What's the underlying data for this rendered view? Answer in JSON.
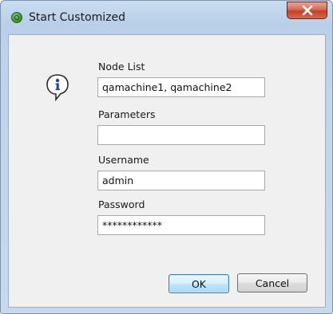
{
  "window": {
    "title": "Start Customized",
    "close_icon": "close-icon"
  },
  "form": {
    "info_icon": "info-icon",
    "node_list": {
      "label": "Node List",
      "value": "qamachine1, qamachine2"
    },
    "parameters": {
      "label": "Parameters",
      "value": ""
    },
    "username": {
      "label": "Username",
      "value": "admin"
    },
    "password": {
      "label": "Password",
      "value": "************"
    }
  },
  "buttons": {
    "ok": "OK",
    "cancel": "Cancel"
  }
}
